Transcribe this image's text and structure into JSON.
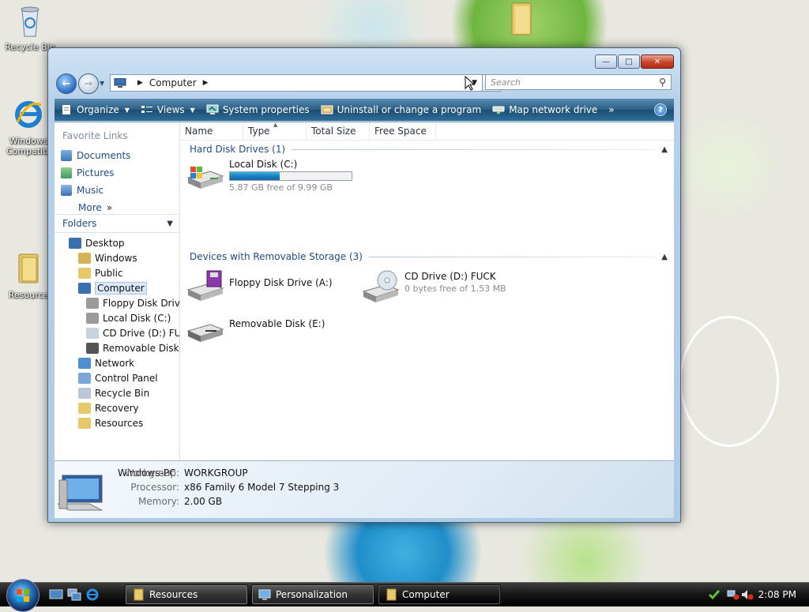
{
  "desktop": {
    "icons": [
      {
        "label": "Recycle Bin",
        "icon": "recycle-bin-icon"
      },
      {
        "label": "Windows\nCompatibi",
        "icon": "internet-explorer-icon"
      },
      {
        "label": "Resource",
        "icon": "folder-icon"
      }
    ]
  },
  "window": {
    "address": {
      "location": "Computer"
    },
    "search": {
      "placeholder": "Search"
    },
    "toolbar": {
      "organize": "Organize",
      "views": "Views",
      "system_properties": "System properties",
      "uninstall": "Uninstall or change a program",
      "map_drive": "Map network drive",
      "more": "»"
    },
    "favorites": {
      "title": "Favorite Links",
      "items": [
        "Documents",
        "Pictures",
        "Music"
      ],
      "more": "More"
    },
    "folders": {
      "title": "Folders",
      "tree": [
        {
          "label": "Desktop",
          "icon": "desktop-icon"
        },
        {
          "label": "Windows",
          "icon": "user-folder-icon"
        },
        {
          "label": "Public",
          "icon": "folder-icon"
        },
        {
          "label": "Computer",
          "icon": "computer-icon",
          "selected": true
        },
        {
          "label": "Floppy Disk Drive",
          "icon": "floppy-drive-icon"
        },
        {
          "label": "Local Disk (C:)",
          "icon": "hard-disk-icon"
        },
        {
          "label": "CD Drive (D:) FUC",
          "icon": "cd-drive-icon"
        },
        {
          "label": "Removable Disk (E",
          "icon": "removable-disk-icon"
        },
        {
          "label": "Network",
          "icon": "network-icon"
        },
        {
          "label": "Control Panel",
          "icon": "control-panel-icon"
        },
        {
          "label": "Recycle Bin",
          "icon": "recycle-bin-icon"
        },
        {
          "label": "Recovery",
          "icon": "folder-icon"
        },
        {
          "label": "Resources",
          "icon": "folder-icon"
        }
      ]
    },
    "columns": [
      "Name",
      "Type",
      "Total Size",
      "Free Space"
    ],
    "groups": {
      "hdd": {
        "title": "Hard Disk Drives (1)",
        "drives": [
          {
            "name": "Local Disk (C:)",
            "free": "5.87 GB free of 9.99 GB",
            "used_fraction": 0.41
          }
        ]
      },
      "removable": {
        "title": "Devices with Removable Storage (3)",
        "drives": [
          {
            "name": "Floppy Disk Drive (A:)"
          },
          {
            "name": "CD Drive (D:) FUCK",
            "free": "0 bytes free of 1.53 MB"
          },
          {
            "name": "Removable Disk (E:)"
          }
        ]
      }
    },
    "details": {
      "pc_name": "Windows-PC",
      "workgroup_label": "Workgroup:",
      "workgroup": "WORKGROUP",
      "processor_label": "Processor:",
      "processor": "x86 Family 6 Model 7 Stepping 3",
      "memory_label": "Memory:",
      "memory": "2.00 GB"
    }
  },
  "taskbar": {
    "buttons": [
      "Resources",
      "Personalization",
      "Computer"
    ],
    "clock": "2:08 PM"
  }
}
